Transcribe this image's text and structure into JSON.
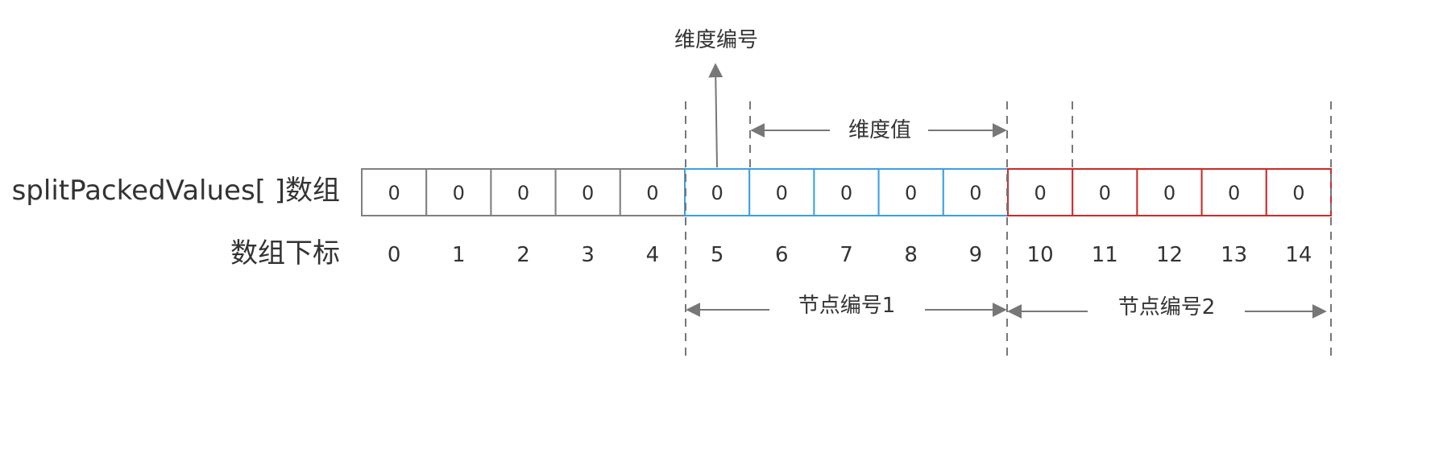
{
  "row_labels": {
    "array": "splitPackedValues[ ]数组",
    "index": "数组下标"
  },
  "annotations": {
    "dim_id": "维度编号",
    "dim_value": "维度值",
    "node1": "节点编号1",
    "node2": "节点编号2"
  },
  "cells": [
    "0",
    "0",
    "0",
    "0",
    "0",
    "0",
    "0",
    "0",
    "0",
    "0",
    "0",
    "0",
    "0",
    "0",
    "0"
  ],
  "indices": [
    "0",
    "1",
    "2",
    "3",
    "4",
    "5",
    "6",
    "7",
    "8",
    "9",
    "10",
    "11",
    "12",
    "13",
    "14"
  ],
  "colors": {
    "group0": "#808080",
    "group1": "#3b9ee6",
    "group2": "#cc2a2a",
    "guide": "#777777",
    "text": "#333333"
  }
}
